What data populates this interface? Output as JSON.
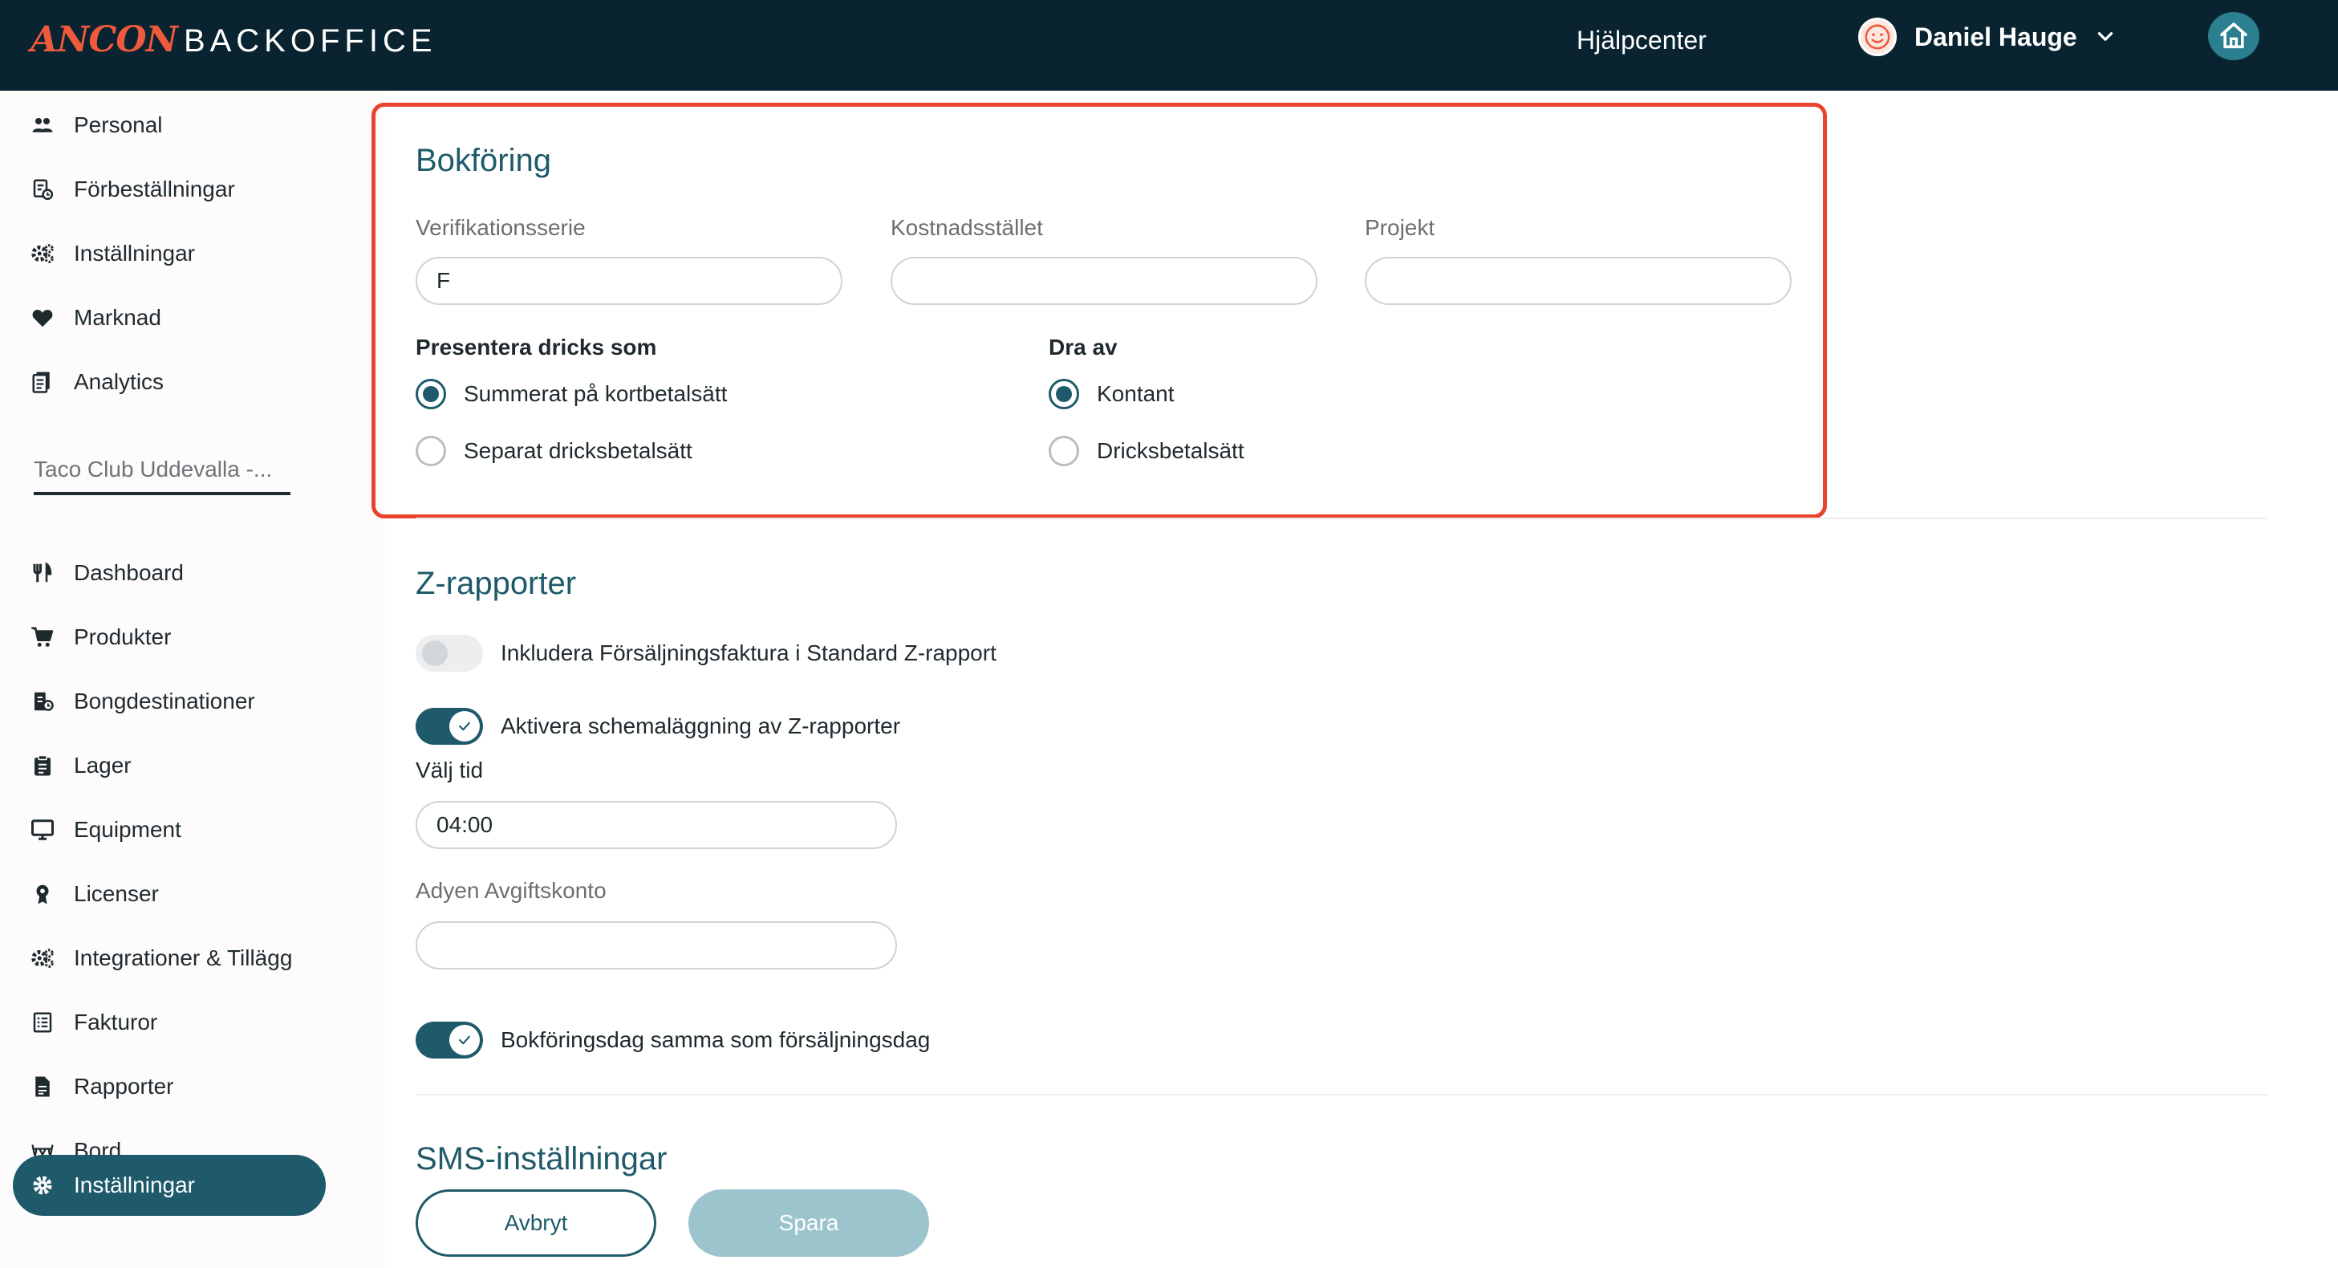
{
  "header": {
    "brand_primary": "ANCON",
    "brand_secondary": "BACKOFFICE",
    "help_label": "Hjälpcenter",
    "user_name": "Daniel Hauge"
  },
  "sidebar": {
    "top_items": [
      {
        "label": "Personal",
        "icon": "users-icon"
      },
      {
        "label": "Förbeställningar",
        "icon": "preorder-icon"
      },
      {
        "label": "Inställningar",
        "icon": "gears-icon"
      },
      {
        "label": "Marknad",
        "icon": "heart-icon"
      },
      {
        "label": "Analytics",
        "icon": "analytics-icon"
      }
    ],
    "site_name": "Taco Club Uddevalla -...",
    "items": [
      {
        "label": "Dashboard",
        "icon": "fork-knife-icon"
      },
      {
        "label": "Produkter",
        "icon": "cart-icon"
      },
      {
        "label": "Bongdestinationer",
        "icon": "printer-icon"
      },
      {
        "label": "Lager",
        "icon": "clipboard-icon"
      },
      {
        "label": "Equipment",
        "icon": "monitor-icon"
      },
      {
        "label": "Licenser",
        "icon": "license-icon"
      },
      {
        "label": "Integrationer & Tillägg",
        "icon": "gears-icon"
      },
      {
        "label": "Fakturor",
        "icon": "invoice-icon"
      },
      {
        "label": "Rapporter",
        "icon": "report-icon"
      },
      {
        "label": "Bord",
        "icon": "table-icon"
      },
      {
        "label": "Inställningar",
        "icon": "gear-icon",
        "active": true
      }
    ]
  },
  "bokforing": {
    "title": "Bokföring",
    "verifikationsserie_label": "Verifikationsserie",
    "verifikationsserie_value": "F",
    "kostnadsstallet_label": "Kostnadsstället",
    "kostnadsstallet_value": "",
    "projekt_label": "Projekt",
    "projekt_value": "",
    "dricks_label": "Presentera dricks som",
    "dricks_options": [
      "Summerat på kortbetalsätt",
      "Separat dricksbetalsätt"
    ],
    "dricks_selected": 0,
    "dra_av_label": "Dra av",
    "dra_av_options": [
      "Kontant",
      "Dricksbetalsätt"
    ],
    "dra_av_selected": 0
  },
  "zrapporter": {
    "title": "Z-rapporter",
    "include_invoice_label": "Inkludera Försäljningsfaktura i Standard Z-rapport",
    "include_invoice_on": false,
    "schedule_label": "Aktivera schemaläggning av Z-rapporter",
    "schedule_on": true,
    "time_label": "Välj tid",
    "time_value": "04:00",
    "adyen_label": "Adyen Avgiftskonto",
    "adyen_value": "",
    "booking_day_label": "Bokföringsdag samma som försäljningsdag",
    "booking_day_on": true
  },
  "sms": {
    "title": "SMS-inställningar"
  },
  "actions": {
    "cancel_label": "Avbryt",
    "save_label": "Spara"
  },
  "colors": {
    "header_bg": "#092430",
    "accent": "#1e5a6a",
    "highlight_border": "#e8432d",
    "save_disabled": "#9cc4cd"
  }
}
